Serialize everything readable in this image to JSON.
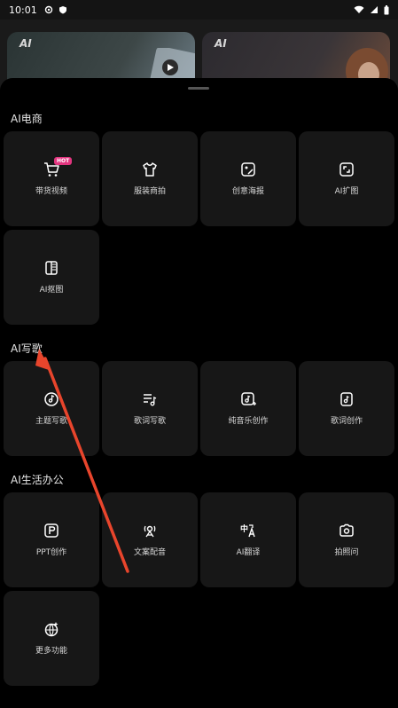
{
  "status": {
    "time": "10:01"
  },
  "banner": {
    "tag1": "AI",
    "tag2": "AI"
  },
  "sections": [
    {
      "title": "AI电商",
      "items": [
        {
          "label": "带货视频",
          "icon": "cart-icon",
          "badge": "HOT"
        },
        {
          "label": "服装商拍",
          "icon": "tshirt-icon"
        },
        {
          "label": "创意海报",
          "icon": "image-edit-icon"
        },
        {
          "label": "AI扩图",
          "icon": "expand-image-icon"
        },
        {
          "label": "AI抠图",
          "icon": "cutout-icon"
        }
      ]
    },
    {
      "title": "AI写歌",
      "items": [
        {
          "label": "主题写歌",
          "icon": "music-disc-icon"
        },
        {
          "label": "歌词写歌",
          "icon": "lyrics-note-icon"
        },
        {
          "label": "纯音乐创作",
          "icon": "music-add-icon"
        },
        {
          "label": "歌词创作",
          "icon": "music-file-icon"
        }
      ]
    },
    {
      "title": "AI生活办公",
      "items": [
        {
          "label": "PPT创作",
          "icon": "ppt-icon"
        },
        {
          "label": "文案配音",
          "icon": "voice-icon"
        },
        {
          "label": "AI翻译",
          "icon": "translate-icon"
        },
        {
          "label": "拍照问",
          "icon": "camera-icon"
        },
        {
          "label": "更多功能",
          "icon": "more-features-icon"
        }
      ]
    }
  ]
}
